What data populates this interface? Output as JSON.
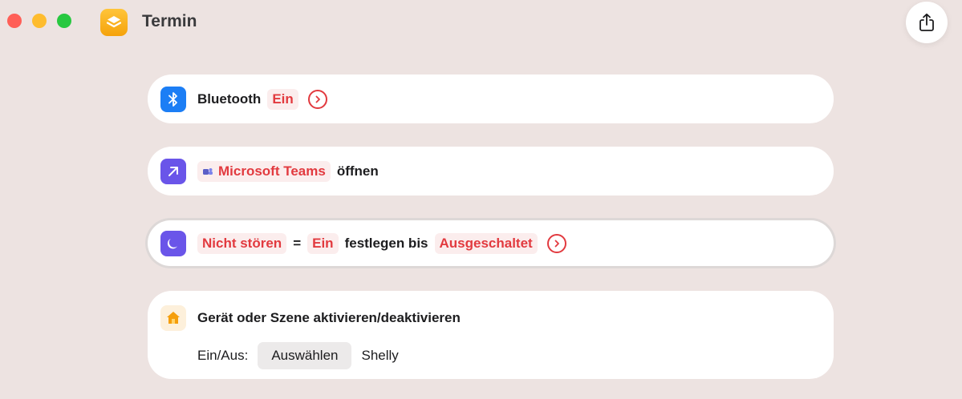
{
  "window": {
    "title": "Termin",
    "app_icon": "layers-icon",
    "share_icon": "share-icon"
  },
  "actions": {
    "bluetooth": {
      "label": "Bluetooth",
      "state": "Ein",
      "icon": "bluetooth-icon"
    },
    "open_app": {
      "app": "Microsoft Teams",
      "verb": "öffnen",
      "icon": "arrow-up-right-icon"
    },
    "focus": {
      "mode": "Nicht stören",
      "equals": "=",
      "state": "Ein",
      "verb": "festlegen bis",
      "until": "Ausgeschaltet",
      "icon": "moon-icon"
    },
    "home": {
      "title": "Gerät oder Szene aktivieren/deaktivieren",
      "param_label": "Ein/Aus:",
      "select_label": "Auswählen",
      "device": "Shelly",
      "icon": "home-icon"
    }
  },
  "colors": {
    "background": "#EDE3E1",
    "token_text": "#E23A3F",
    "token_bg": "#FBEDED",
    "bluetooth_icon_bg": "#1C7EF5",
    "purple_icon_bg": "#6A55E9"
  }
}
